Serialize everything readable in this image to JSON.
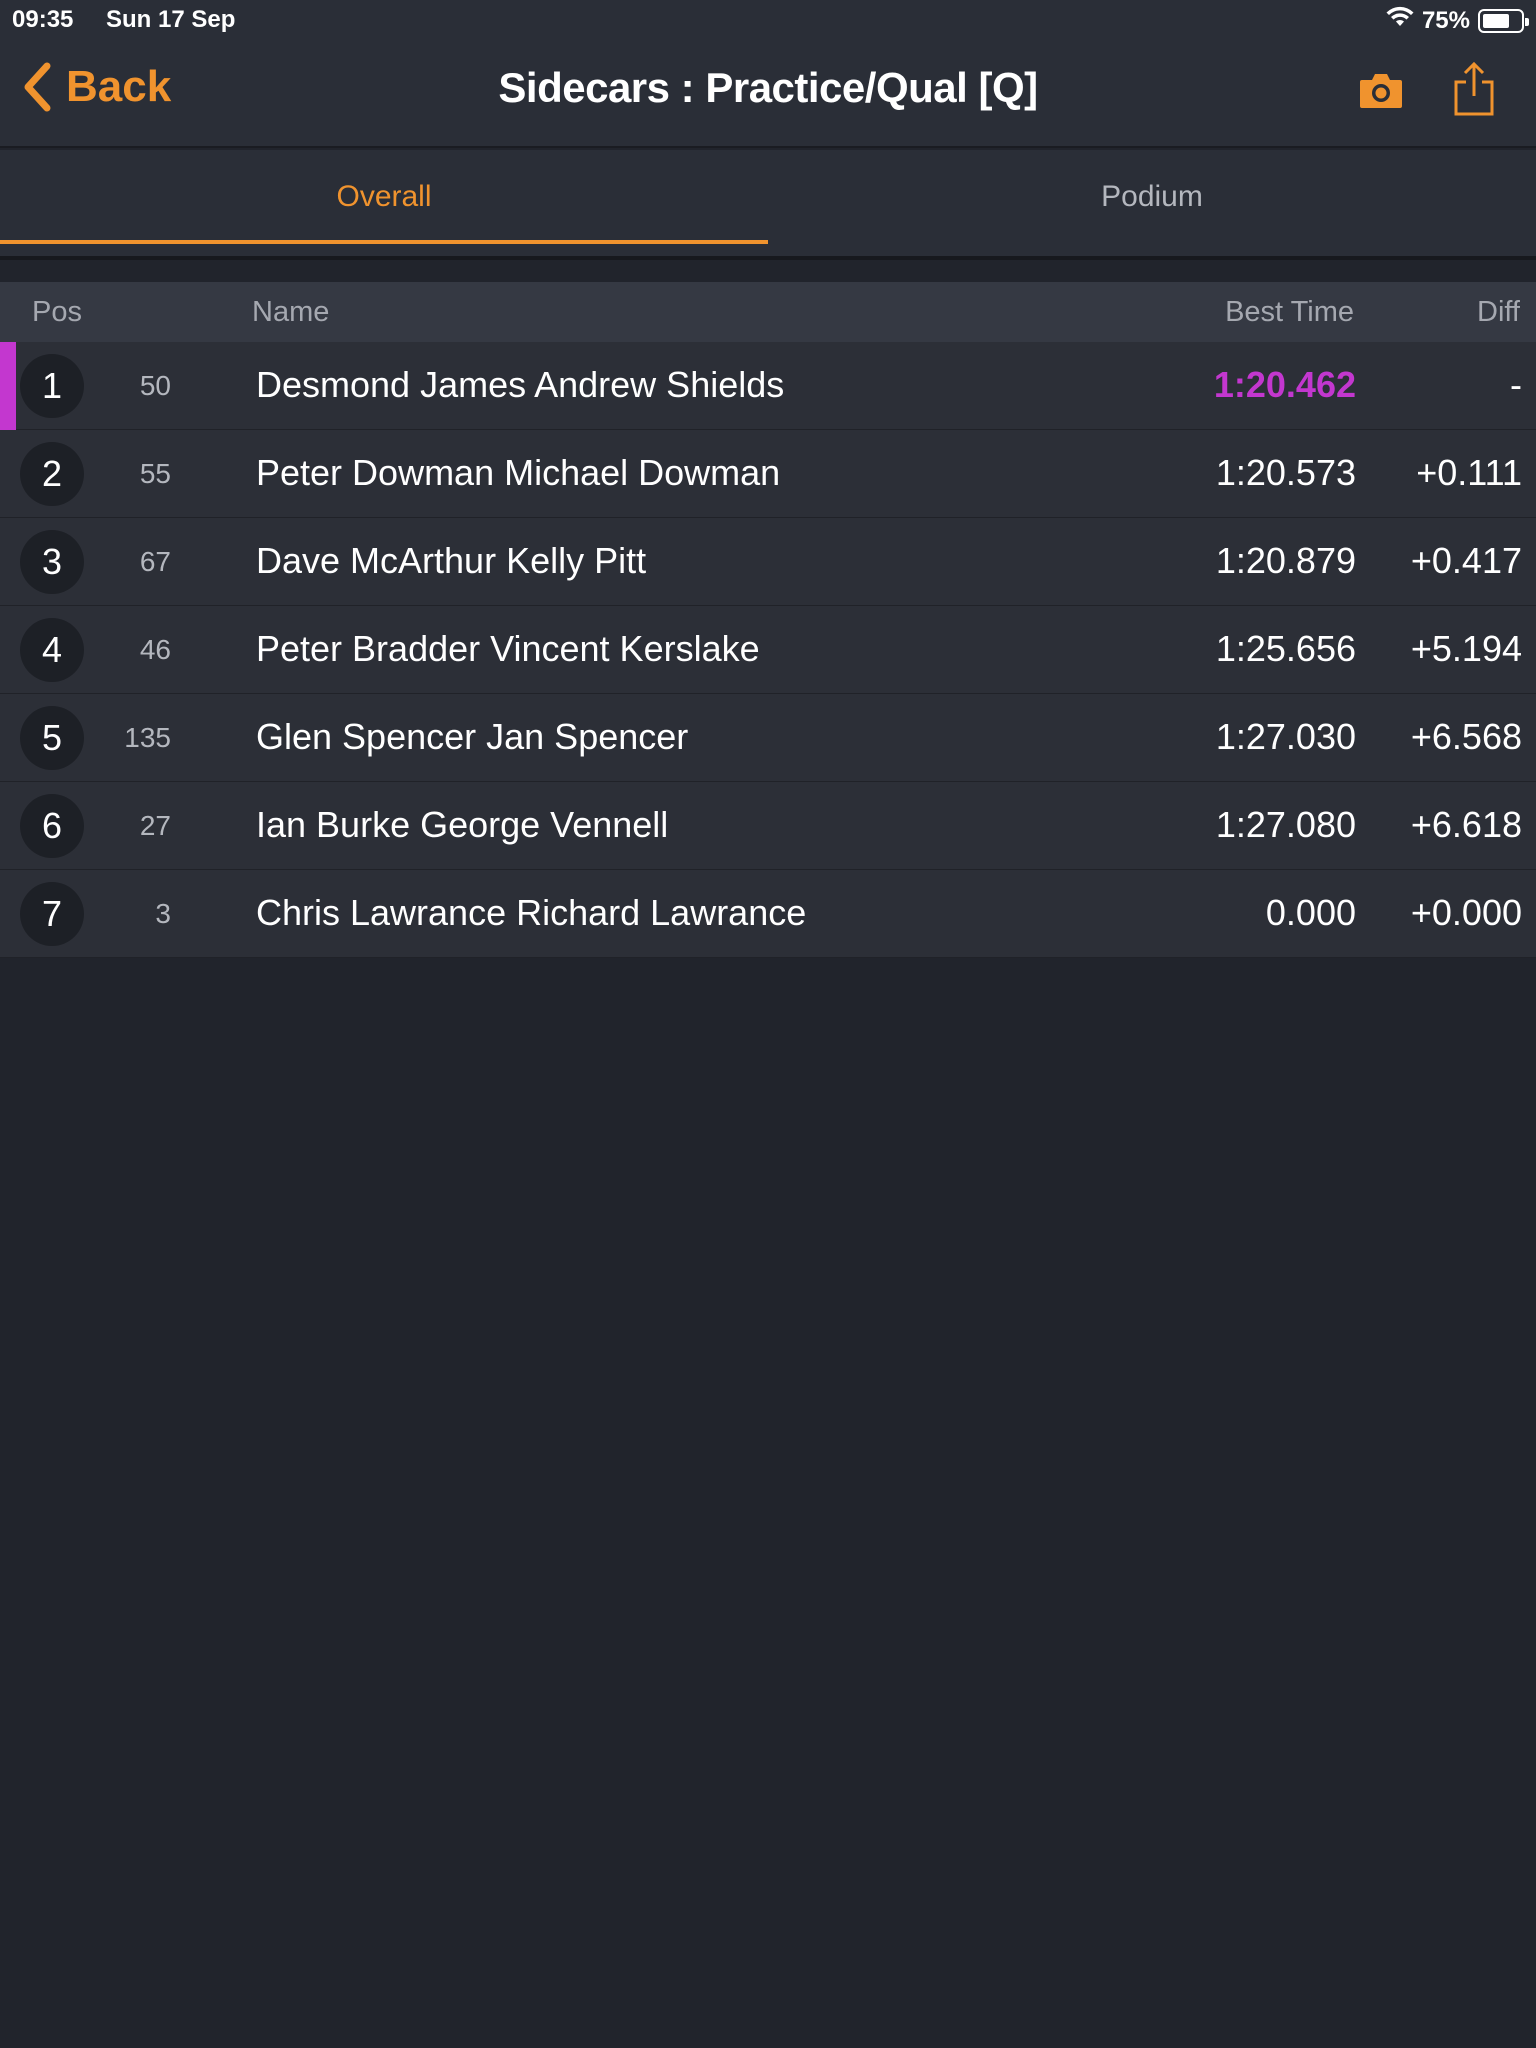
{
  "status": {
    "time": "09:35",
    "date": "Sun 17 Sep",
    "battery": "75%"
  },
  "nav": {
    "back_label": "Back",
    "title": "Sidecars : Practice/Qual [Q]",
    "accent_color": "#f0932e"
  },
  "tabs": [
    {
      "label": "Overall",
      "active": true
    },
    {
      "label": "Podium",
      "active": false
    }
  ],
  "table": {
    "headers": {
      "pos": "Pos",
      "name": "Name",
      "best": "Best Time",
      "diff": "Diff"
    },
    "fastest_color": "#c337cf",
    "rows": [
      {
        "pos": "1",
        "number": "50",
        "name": "Desmond James Andrew Shields",
        "best": "1:20.462",
        "diff": "-"
      },
      {
        "pos": "2",
        "number": "55",
        "name": "Peter Dowman Michael Dowman",
        "best": "1:20.573",
        "diff": "+0.111"
      },
      {
        "pos": "3",
        "number": "67",
        "name": "Dave McArthur Kelly Pitt",
        "best": "1:20.879",
        "diff": "+0.417"
      },
      {
        "pos": "4",
        "number": "46",
        "name": "Peter Bradder Vincent Kerslake",
        "best": "1:25.656",
        "diff": "+5.194"
      },
      {
        "pos": "5",
        "number": "135",
        "name": "Glen Spencer Jan Spencer",
        "best": "1:27.030",
        "diff": "+6.568"
      },
      {
        "pos": "6",
        "number": "27",
        "name": "Ian Burke George Vennell",
        "best": "1:27.080",
        "diff": "+6.618"
      },
      {
        "pos": "7",
        "number": "3",
        "name": "Chris Lawrance Richard Lawrance",
        "best": "0.000",
        "diff": "+0.000"
      }
    ]
  }
}
